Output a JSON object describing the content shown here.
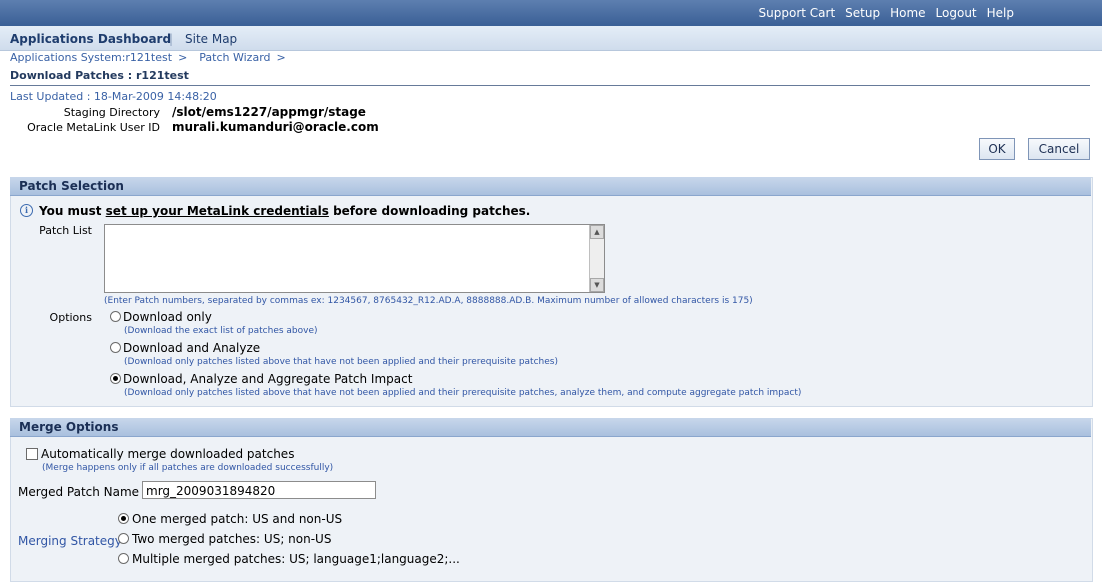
{
  "topbar": {
    "links": [
      "Support Cart",
      "Setup",
      "Home",
      "Logout",
      "Help"
    ]
  },
  "nav": {
    "dashboard": "Applications Dashboard",
    "separator": "|",
    "sitemap": "Site Map"
  },
  "breadcrumbs": [
    {
      "label": "Applications System:r121test",
      "arrow": ">"
    },
    {
      "label": "Patch Wizard",
      "arrow": ">"
    }
  ],
  "page": {
    "title": "Download Patches : r121test",
    "last_updated": "Last Updated : 18-Mar-2009 14:48:20",
    "staging_label": "Staging Directory",
    "staging_value": "/slot/ems1227/appmgr/stage",
    "metalink_label": "Oracle MetaLink User ID",
    "metalink_value": "murali.kumanduri@oracle.com",
    "ok_label": "OK",
    "cancel_label": "Cancel"
  },
  "patch_selection": {
    "header": "Patch Selection",
    "info_pre": "You must ",
    "info_link": "set up your MetaLink credentials",
    "info_post": " before downloading patches.",
    "patch_list_label": "Patch List",
    "patch_list_value": "",
    "patch_list_hint": "(Enter Patch numbers, separated by commas ex: 1234567, 8765432_R12.AD.A, 8888888.AD.B. Maximum number of allowed characters is 175)",
    "options_label": "Options",
    "options": [
      {
        "label": "Download only",
        "hint": "(Download the exact list of patches above)",
        "selected": false
      },
      {
        "label": "Download and Analyze",
        "hint": "(Download only patches listed above that have not been applied and their prerequisite patches)",
        "selected": false
      },
      {
        "label": "Download, Analyze and Aggregate Patch Impact",
        "hint": "(Download only patches listed above that have not been applied and their prerequisite patches, analyze them, and compute aggregate patch impact)",
        "selected": true
      }
    ]
  },
  "merge_options": {
    "header": "Merge Options",
    "auto_merge_label": "Automatically merge downloaded patches",
    "auto_merge_hint": "(Merge happens only if all patches are downloaded successfully)",
    "auto_merge_checked": false,
    "merged_name_label": "Merged Patch Name",
    "merged_name_value": "mrg_2009031894820",
    "strategy_label": "Merging Strategy",
    "strategies": [
      {
        "label": "One merged patch: US and non-US",
        "selected": true
      },
      {
        "label": "Two merged patches: US; non-US",
        "selected": false
      },
      {
        "label": "Multiple merged patches: US; language1;language2;...",
        "selected": false
      }
    ]
  },
  "icons": {
    "info": "info-icon",
    "scroll_up": "scroll-up-icon",
    "scroll_down": "scroll-down-icon"
  }
}
